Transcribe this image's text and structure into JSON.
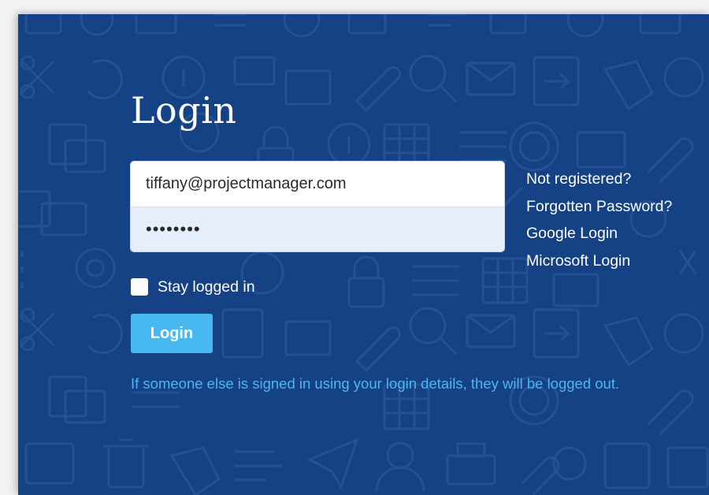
{
  "login": {
    "title": "Login",
    "email_value": "tiffany@projectmanager.com",
    "password_value": "password",
    "links": [
      {
        "label": "Not registered?"
      },
      {
        "label": "Forgotten Password?"
      },
      {
        "label": "Google Login"
      },
      {
        "label": "Microsoft Login"
      }
    ],
    "stay_logged_in_label": "Stay logged in",
    "stay_logged_in_checked": false,
    "submit_label": "Login",
    "notice": "If someone else is signed in using your login details, they will be logged out."
  },
  "colors": {
    "background": "#154284",
    "pattern": "#235192",
    "button": "#47b9f0",
    "notice_text": "#4ab6f3",
    "password_field": "#e7eefb"
  }
}
